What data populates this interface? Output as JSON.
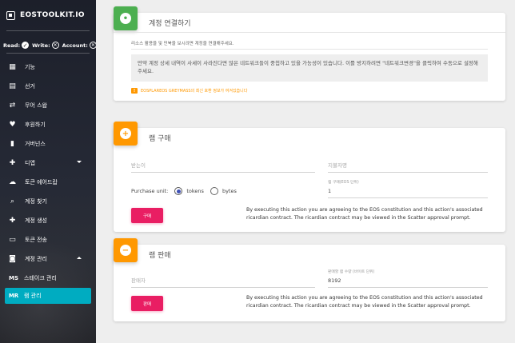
{
  "app": {
    "brand": "EOSTOOLKIT.IO"
  },
  "status": {
    "read_label": "Read:",
    "write_label": "Write:",
    "account_label": "Account:"
  },
  "nav": [
    {
      "label": "기능",
      "icon": "dashboard-icon"
    },
    {
      "label": "선거",
      "icon": "vote-icon"
    },
    {
      "label": "무어 스왑",
      "icon": "swap-icon"
    },
    {
      "label": "후원하기",
      "icon": "heart-icon"
    },
    {
      "label": "거버넌스",
      "icon": "governance-icon"
    },
    {
      "label": "디앱",
      "icon": "puzzle-icon"
    },
    {
      "label": "토큰 에어드랍",
      "icon": "cloud-download-icon"
    },
    {
      "label": "계정 찾기",
      "icon": "search-icon"
    },
    {
      "label": "계정 생성",
      "icon": "add-person-icon"
    },
    {
      "label": "토큰 전송",
      "icon": "credit-card-icon"
    },
    {
      "label": "계정 관리",
      "icon": "account-box-icon"
    }
  ],
  "subnav": [
    {
      "abbr": "MS",
      "label": "스테이크 관리"
    },
    {
      "abbr": "MR",
      "label": "램 관리"
    }
  ],
  "connect": {
    "title": "계정 연결하기",
    "subtitle": "리소스 활용을 및 민북을 보시려면 계정을 연결해주세요.",
    "notice": "만약 계정 상세 내역이 사세이 사라진다면 많은 네트워크들이 중첩하고 있을 가능성이 있습니다. 이를 방지하려면 \"네트워크변경\"을 클릭하여 수동으로 설정해주세요.",
    "warning": "EOSPLAREOS GREYMASS의 최신 호환 정보가 여겨있습니다"
  },
  "buy": {
    "title": "램 구매",
    "receiver_placeholder": "받는이",
    "payer_placeholder": "지불자명",
    "purchase_unit_label": "Purchase unit:",
    "unit_tokens": "tokens",
    "unit_bytes": "bytes",
    "amount_label": "램 구매(EOS 단위)",
    "amount_value": "1",
    "button": "구매",
    "legal": "By executing this action you are agreeing to the EOS constitution and this action's associated ricardian contract. The ricardian contract may be viewed in the Scatter approval prompt."
  },
  "sell": {
    "title": "램 판매",
    "seller_placeholder": "판매자",
    "amount_label": "판매할 램 수량 (바이트 단위)",
    "amount_value": "8192",
    "button": "판매",
    "legal": "By executing this action you are agreeing to the EOS constitution and this action's associated ricardian contract. The ricardian contract may be viewed in the Scatter approval prompt."
  }
}
